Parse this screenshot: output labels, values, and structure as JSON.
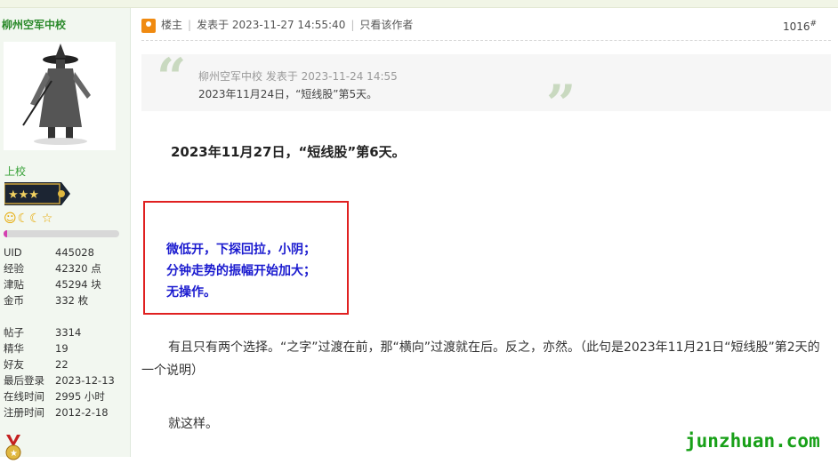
{
  "sidebar": {
    "username": "柳州空军中校",
    "rank": "上校",
    "level_bar_fraction": 0.03,
    "stats": [
      {
        "label": "UID",
        "value": "445028"
      },
      {
        "label": "经验",
        "value": "42320 点"
      },
      {
        "label": "津贴",
        "value": "45294 块"
      },
      {
        "label": "金币",
        "value": "332 枚"
      }
    ],
    "stats2": [
      {
        "label": "帖子",
        "value": "3314"
      },
      {
        "label": "精华",
        "value": "19"
      },
      {
        "label": "好友",
        "value": "22"
      },
      {
        "label": "最后登录",
        "value": "2023-12-13"
      },
      {
        "label": "在线时间",
        "value": "2995 小时"
      },
      {
        "label": "注册时间",
        "value": "2012-2-18"
      }
    ]
  },
  "post": {
    "role": "楼主",
    "posted_at": "发表于 2023-11-27 14:55:40",
    "only_author": "只看该作者",
    "floor": "1016",
    "floor_mark": "#",
    "quote_meta": "柳州空军中校 发表于 2023-11-24 14:55",
    "quote_text": "2023年11月24日，“短线股”第5天。",
    "title": "2023年11月27日，“短线股”第6天。",
    "box_lines": [
      "微低开，下探回拉，小阴；",
      "分钟走势的振幅开始加大；",
      "无操作。"
    ],
    "paragraph": "有且只有两个选择。“之字”过渡在前，那“横向”过渡就在后。反之，亦然。（此句是2023年11月21日“短线股”第2天的一个说明）",
    "ending": "就这样。"
  },
  "watermark": "junzhuan.com",
  "colors": {
    "username": "#2b8a2b",
    "box_border": "#e02020",
    "box_text": "#1a1acf",
    "watermark": "#18a018"
  }
}
